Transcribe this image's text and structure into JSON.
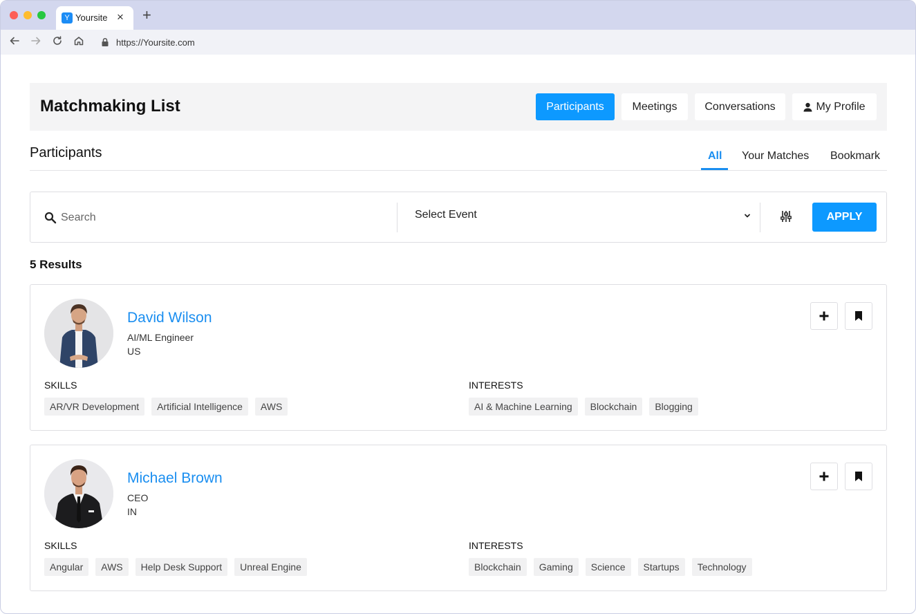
{
  "browser": {
    "tab_title": "Yoursite",
    "favicon_letter": "Y",
    "url": "https://Yoursite.com",
    "icons": [
      "back-arrow-icon",
      "forward-arrow-icon",
      "reload-icon",
      "home-icon",
      "lock-icon",
      "close-icon",
      "plus-icon"
    ]
  },
  "header": {
    "title": "Matchmaking List",
    "buttons": [
      {
        "label": "Participants",
        "active": true
      },
      {
        "label": "Meetings",
        "active": false
      },
      {
        "label": "Conversations",
        "active": false
      },
      {
        "label": "My Profile",
        "active": false,
        "icon": "user-icon"
      }
    ]
  },
  "section": {
    "title": "Participants",
    "tabs": [
      {
        "label": "All",
        "active": true
      },
      {
        "label": "Your Matches",
        "active": false
      },
      {
        "label": "Bookmark",
        "active": false
      }
    ]
  },
  "filters": {
    "search_placeholder": "Search",
    "search_value": "",
    "event_select": "Select Event",
    "apply_label": "APPLY"
  },
  "results_label": "5 Results",
  "participants": [
    {
      "name": "David Wilson",
      "role": "AI/ML Engineer",
      "country": "US",
      "skills_label": "SKILLS",
      "interests_label": "INTERESTS",
      "skills": [
        "AR/VR Development",
        "Artificial Intelligence",
        "AWS"
      ],
      "interests": [
        "AI & Machine Learning",
        "Blockchain",
        "Blogging"
      ]
    },
    {
      "name": "Michael Brown",
      "role": "CEO",
      "country": "IN",
      "skills_label": "SKILLS",
      "interests_label": "INTERESTS",
      "skills": [
        "Angular",
        "AWS",
        "Help Desk Support",
        "Unreal Engine"
      ],
      "interests": [
        "Blockchain",
        "Gaming",
        "Science",
        "Startups",
        "Technology"
      ]
    }
  ],
  "colors": {
    "accent": "#0d99ff",
    "link": "#1a8ef0",
    "titlebar": "#d3d7ee",
    "chip_bg": "#f1f1f2"
  }
}
